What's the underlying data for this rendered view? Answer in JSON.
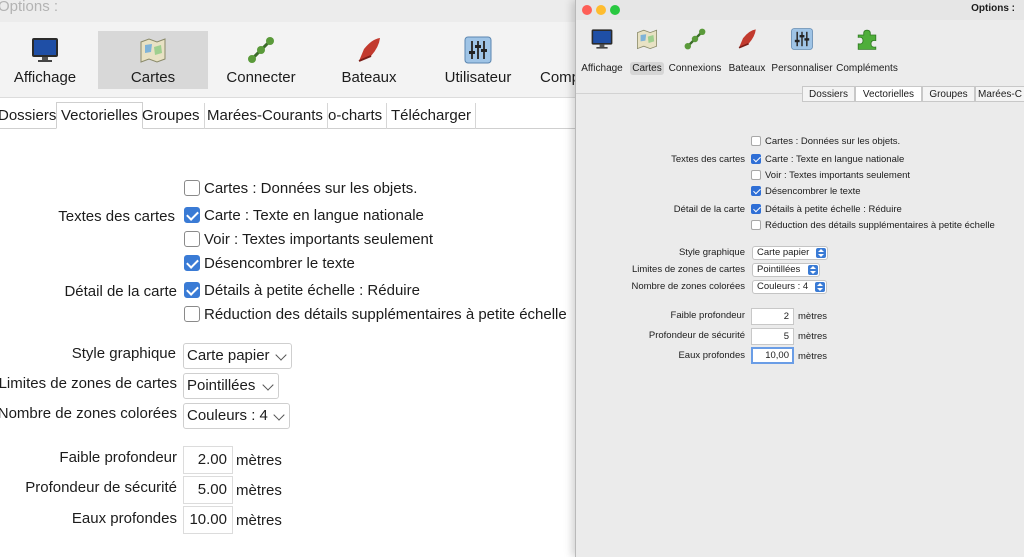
{
  "background_window": {
    "title": "Options :",
    "toolbar": [
      "Affichage",
      "Cartes",
      "Connecter",
      "Bateaux",
      "Utilisateur",
      "Comp"
    ],
    "tabs": [
      "Dossiers",
      "Vectorielles",
      "Groupes",
      "Marées-Courants",
      "o-charts",
      "Télécharger"
    ],
    "active_tab": "Vectorielles",
    "text_label": "Textes des cartes",
    "detail_label": "Détail de la carte",
    "checkboxes": [
      {
        "label": "Cartes : Données sur les objets.",
        "checked": false
      },
      {
        "label": "Carte : Texte en langue nationale",
        "checked": true
      },
      {
        "label": "Voir : Textes importants seulement",
        "checked": false
      },
      {
        "label": "Désencombrer le texte",
        "checked": true
      },
      {
        "label": "Détails à petite échelle : Réduire",
        "checked": true
      },
      {
        "label": "Réduction des détails supplémentaires à petite échelle",
        "checked": false
      }
    ],
    "selects": [
      {
        "label": "Style graphique",
        "value": "Carte papier"
      },
      {
        "label": "Limites de zones de cartes",
        "value": "Pointillées"
      },
      {
        "label": "Nombre de zones colorées",
        "value": "Couleurs : 4"
      }
    ],
    "depths": [
      {
        "label": "Faible profondeur",
        "value": "2.00",
        "unit": "mètres"
      },
      {
        "label": "Profondeur de sécurité",
        "value": "5.00",
        "unit": "mètres"
      },
      {
        "label": "Eaux profondes",
        "value": "10.00",
        "unit": "mètres"
      }
    ]
  },
  "foreground_window": {
    "title": "Options :",
    "toolbar": [
      "Affichage",
      "Cartes",
      "Connexions",
      "Bateaux",
      "Personnaliser",
      "Compléments"
    ],
    "tabs": [
      "Dossiers",
      "Vectorielles",
      "Groupes",
      "Marées-C"
    ],
    "active_tab": "Vectorielles",
    "text_label": "Textes des cartes",
    "detail_label": "Détail de la carte",
    "checkboxes": [
      {
        "label": "Cartes : Données sur les objets.",
        "checked": false
      },
      {
        "label": "Carte : Texte en langue nationale",
        "checked": true
      },
      {
        "label": "Voir : Textes importants seulement",
        "checked": false
      },
      {
        "label": "Désencombrer le texte",
        "checked": true
      },
      {
        "label": "Détails à petite échelle : Réduire",
        "checked": true
      },
      {
        "label": "Réduction des détails supplémentaires à petite échelle",
        "checked": false
      }
    ],
    "selects": [
      {
        "label": "Style graphique",
        "value": "Carte papier"
      },
      {
        "label": "Limites de zones de cartes",
        "value": "Pointillées"
      },
      {
        "label": "Nombre de zones colorées",
        "value": "Couleurs : 4"
      }
    ],
    "depths": [
      {
        "label": "Faible profondeur",
        "value": "2",
        "unit": "mètres"
      },
      {
        "label": "Profondeur de sécurité",
        "value": "5",
        "unit": "mètres"
      },
      {
        "label": "Eaux profondes",
        "value": "10,00",
        "unit": "mètres"
      }
    ],
    "traffic_lights": {
      "close": "#fe5f57",
      "minimize": "#febc2e",
      "zoom": "#28c840"
    }
  },
  "colors": {
    "accent": "#3a7bd5"
  }
}
